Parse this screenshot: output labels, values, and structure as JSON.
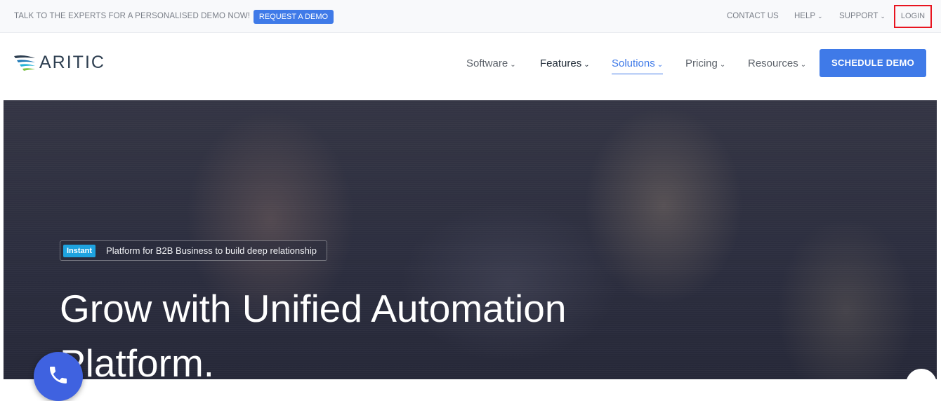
{
  "topbar": {
    "promo_text": "TALK TO THE EXPERTS FOR A PERSONALISED DEMO NOW!",
    "request_demo_label": "REQUEST A DEMO",
    "contact_label": "CONTACT US",
    "help_label": "HELP",
    "support_label": "SUPPORT",
    "login_label": "LOGIN"
  },
  "brand": {
    "logo_text": "ARITIC"
  },
  "nav": {
    "items": [
      {
        "label": "Software"
      },
      {
        "label": "Features"
      },
      {
        "label": "Solutions"
      },
      {
        "label": "Pricing"
      },
      {
        "label": "Resources"
      }
    ],
    "schedule_demo_label": "SCHEDULE DEMO"
  },
  "hero": {
    "badge_label": "Instant",
    "tagline": "Platform for B2B Business to build deep relationship",
    "headline": "Grow with Unified Automation Platform."
  },
  "icons": {
    "chevron": "chevron-down-icon",
    "phone": "phone-icon",
    "logo": "aritic-wing-icon"
  },
  "colors": {
    "accent": "#3f7ae8",
    "login_highlight": "#e8141f",
    "badge": "#1ea3e0",
    "hero_overlay": "#2c2e3f"
  }
}
